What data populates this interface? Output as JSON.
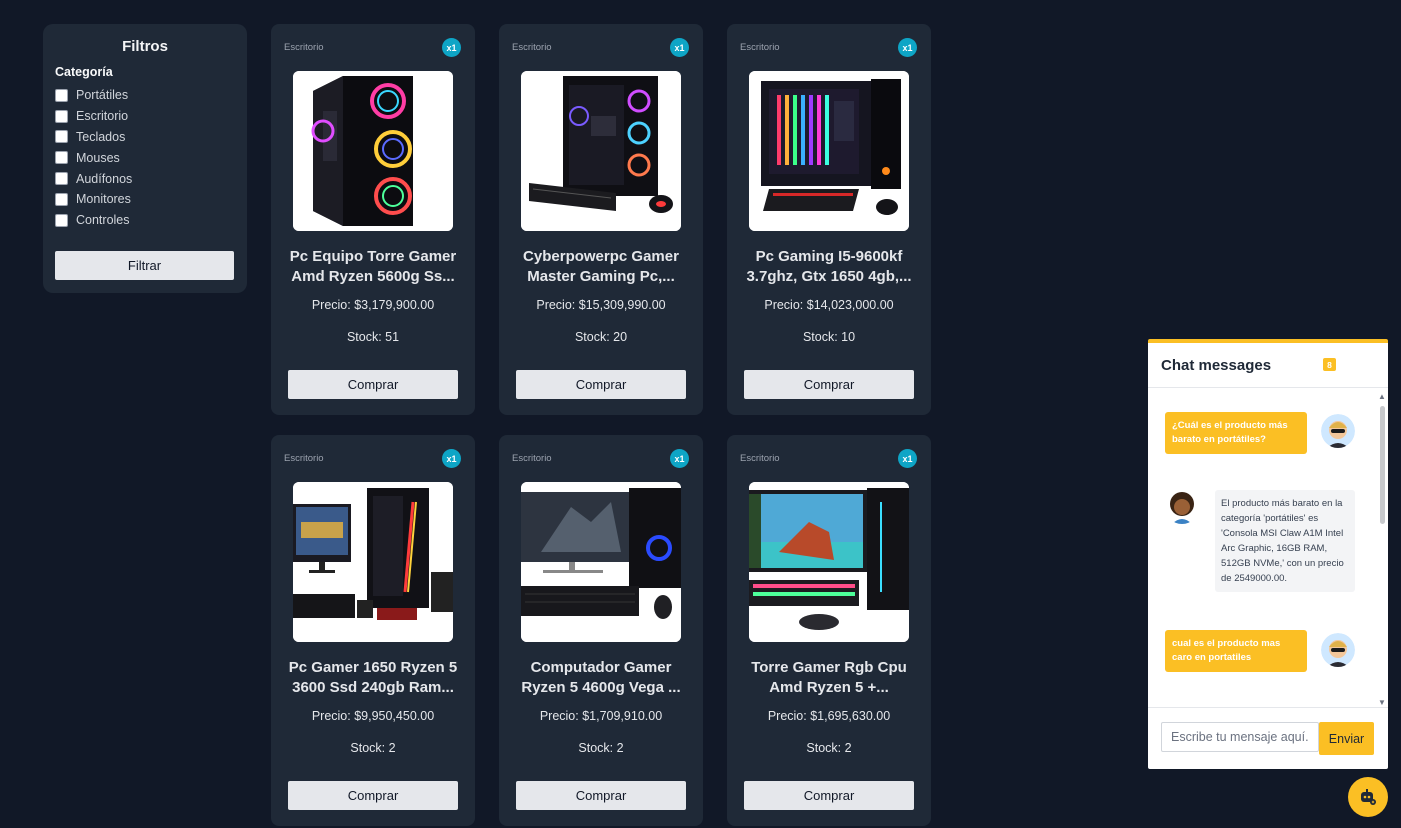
{
  "filters": {
    "title": "Filtros",
    "category_label": "Categoría",
    "categories": [
      "Portátiles",
      "Escritorio",
      "Teclados",
      "Mouses",
      "Audífonos",
      "Monitores",
      "Controles"
    ],
    "button_label": "Filtrar"
  },
  "products": [
    {
      "category": "Escritorio",
      "badge": "x1",
      "name": "Pc Equipo Torre Gamer Amd Ryzen 5600g Ss...",
      "price": "Precio: $3,179,900.00",
      "stock": "Stock: 51",
      "buy_label": "Comprar",
      "image": "gaming-tower-rgb-fans"
    },
    {
      "category": "Escritorio",
      "badge": "x1",
      "name": "Cyberpowerpc Gamer Master Gaming Pc,...",
      "price": "Precio: $15,309,990.00",
      "stock": "Stock: 20",
      "buy_label": "Comprar",
      "image": "gaming-pc-keyboard-mouse"
    },
    {
      "category": "Escritorio",
      "badge": "x1",
      "name": "Pc Gaming I5-9600kf 3.7ghz, Gtx 1650 4gb,...",
      "price": "Precio: $14,023,000.00",
      "stock": "Stock: 10",
      "buy_label": "Comprar",
      "image": "gaming-pc-rgb-strips"
    },
    {
      "category": "Escritorio",
      "badge": "x1",
      "name": "Pc Gamer 1650 Ryzen 5 3600 Ssd 240gb Ram...",
      "price": "Precio: $9,950,450.00",
      "stock": "Stock: 2",
      "buy_label": "Comprar",
      "image": "pc-bundle-monitor"
    },
    {
      "category": "Escritorio",
      "badge": "x1",
      "name": "Computador Gamer Ryzen 5 4600g Vega ...",
      "price": "Precio: $1,709,910.00",
      "stock": "Stock: 2",
      "buy_label": "Comprar",
      "image": "pc-monitor-keyboard"
    },
    {
      "category": "Escritorio",
      "badge": "x1",
      "name": "Torre Gamer Rgb Cpu Amd Ryzen 5 +...",
      "price": "Precio: $1,695,630.00",
      "stock": "Stock: 2",
      "buy_label": "Comprar",
      "image": "pc-monitor-beach"
    }
  ],
  "chat": {
    "title": "Chat messages",
    "count": "8",
    "messages": [
      {
        "from": "user",
        "text": "¿Cuál es el producto más barato en portátiles?"
      },
      {
        "from": "bot",
        "text": "El producto más barato en la categoría 'portátiles' es 'Consola MSI Claw A1M Intel Arc Graphic, 16GB RAM, 512GB NVMe,' con un precio de 2549000.00."
      },
      {
        "from": "user",
        "text": "cual es el producto mas caro en portatiles"
      }
    ],
    "input_placeholder": "Escribe tu mensaje aquí...",
    "send_label": "Enviar"
  },
  "colors": {
    "background": "#111827",
    "panel": "#1f2937",
    "accent": "#fbbf24",
    "badge": "#0ea5c6"
  }
}
